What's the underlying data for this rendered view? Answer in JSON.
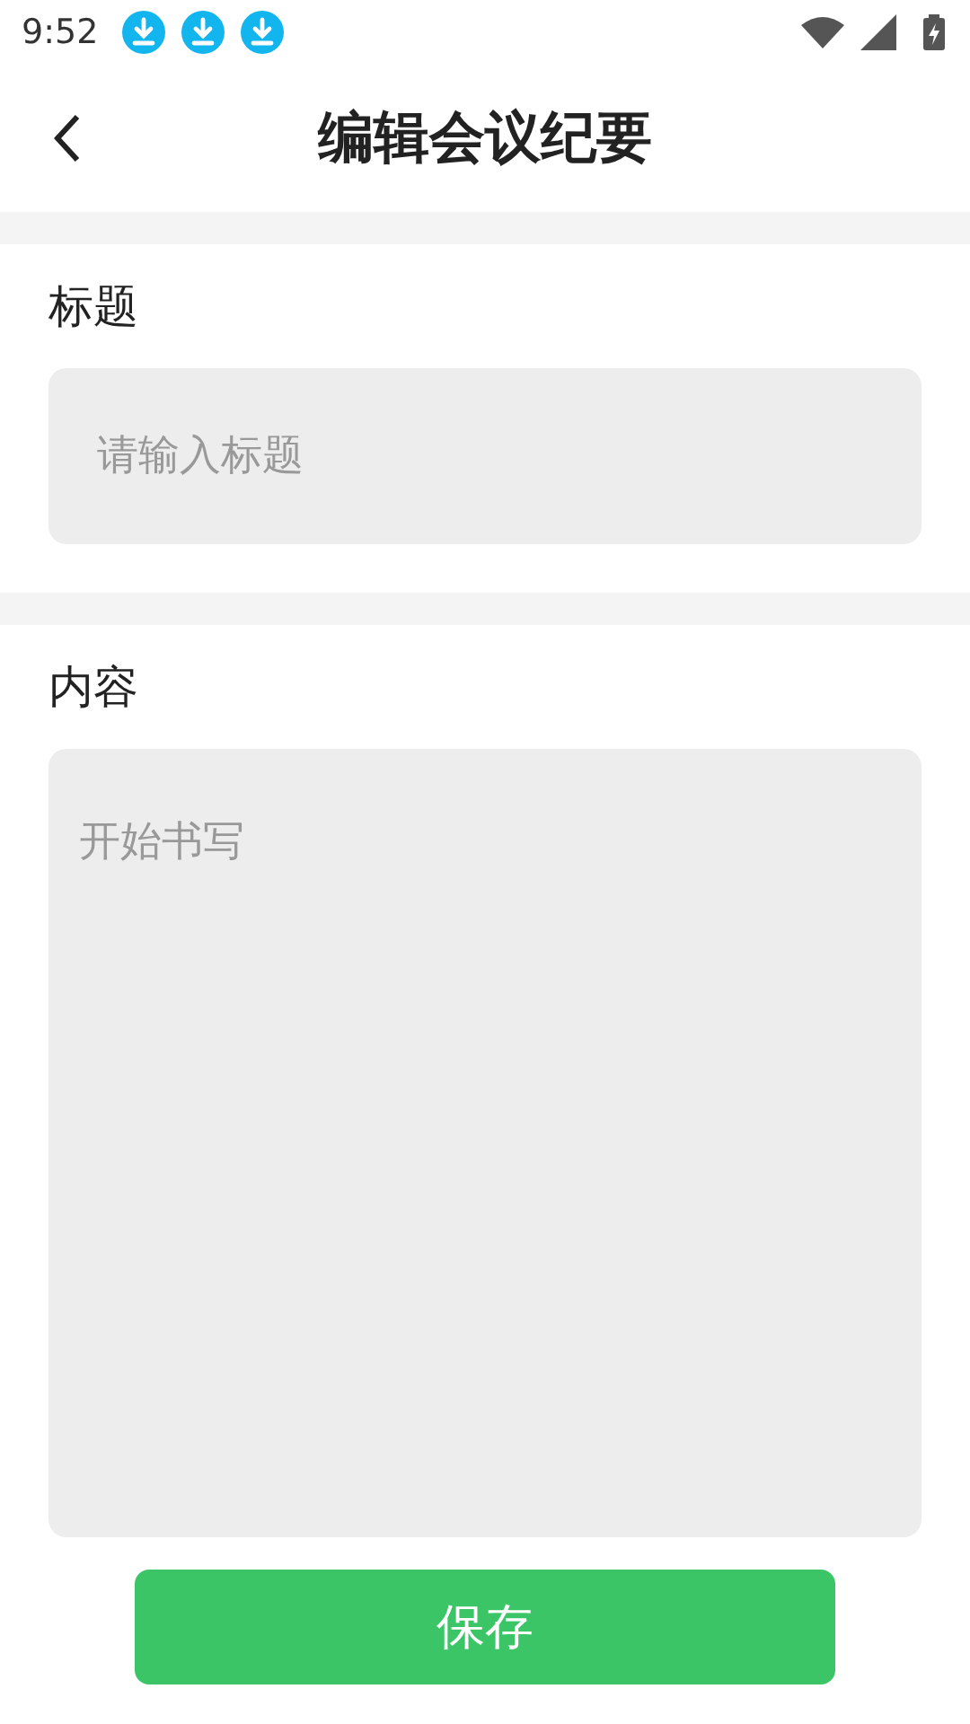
{
  "status_bar": {
    "time": "9:52",
    "notifications": [
      {
        "kind": "download"
      },
      {
        "kind": "download"
      },
      {
        "kind": "download"
      }
    ]
  },
  "header": {
    "title": "编辑会议纪要"
  },
  "title_section": {
    "label": "标题",
    "placeholder": "请输入标题"
  },
  "content_section": {
    "label": "内容",
    "placeholder": "开始书写"
  },
  "save_button": {
    "label": "保存"
  }
}
